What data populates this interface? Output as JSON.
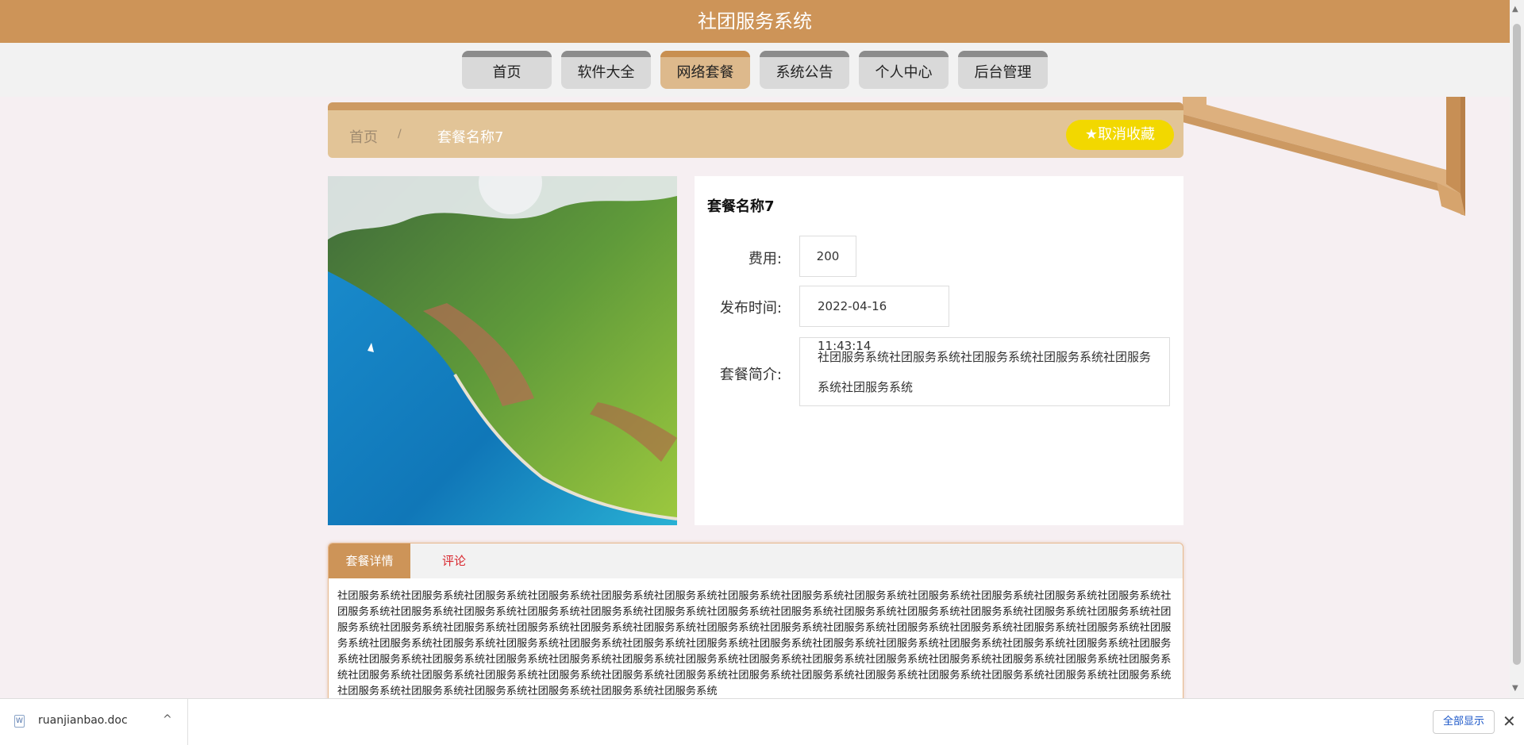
{
  "app": {
    "title": "社团服务系统"
  },
  "nav": {
    "items": [
      {
        "label": "首页"
      },
      {
        "label": "软件大全"
      },
      {
        "label": "网络套餐"
      },
      {
        "label": "系统公告"
      },
      {
        "label": "个人中心"
      },
      {
        "label": "后台管理"
      }
    ],
    "active": "网络套餐"
  },
  "breadcrumb": {
    "home": "首页",
    "separator": "/",
    "current": "套餐名称7"
  },
  "favorite_button": {
    "label": "取消收藏",
    "icon": "star-icon"
  },
  "package": {
    "name": "套餐名称7",
    "fee_label": "费用:",
    "fee_value": "200",
    "time_label": "发布时间:",
    "time_value": "2022-04-16 11:43:14",
    "intro_label": "套餐简介:",
    "intro_value": "社团服务系统社团服务系统社团服务系统社团服务系统社团服务系统社团服务系统"
  },
  "tabs": {
    "detail": "套餐详情",
    "comment": "评论"
  },
  "detail_text": "社团服务系统社团服务系统社团服务系统社团服务系统社团服务系统社团服务系统社团服务系统社团服务系统社团服务系统社团服务系统社团服务系统社团服务系统社团服务系统社团服务系统社团服务系统社团服务系统社团服务系统社团服务系统社团服务系统社团服务系统社团服务系统社团服务系统社团服务系统社团服务系统社团服务系统社团服务系统社团服务系统社团服务系统社团服务系统社团服务系统社团服务系统社团服务系统社团服务系统社团服务系统社团服务系统社团服务系统社团服务系统社团服务系统社团服务系统社团服务系统社团服务系统社团服务系统社团服务系统社团服务系统社团服务系统社团服务系统社团服务系统社团服务系统社团服务系统社团服务系统社团服务系统社团服务系统社团服务系统社团服务系统社团服务系统社团服务系统社团服务系统社团服务系统社团服务系统社团服务系统社团服务系统社团服务系统社团服务系统社团服务系统社团服务系统社团服务系统社团服务系统社团服务系统社团服务系统社团服务系统社团服务系统社团服务系统社团服务系统社团服务系统社团服务系统社团服务系统社团服务系统社团服务系统社团服务系统社团服务系统社团服务系统社团服务系统社团服务系统社团服务系统社团服务系统",
  "downloads": {
    "file_name": "ruanjianbao.doc",
    "show_all": "全部显示",
    "close_icon": "close-icon"
  },
  "colors": {
    "primary": "#cd9458",
    "accent_yellow": "#f2d800",
    "tab_active": "#cd9458",
    "comment_red": "#d9282f"
  }
}
